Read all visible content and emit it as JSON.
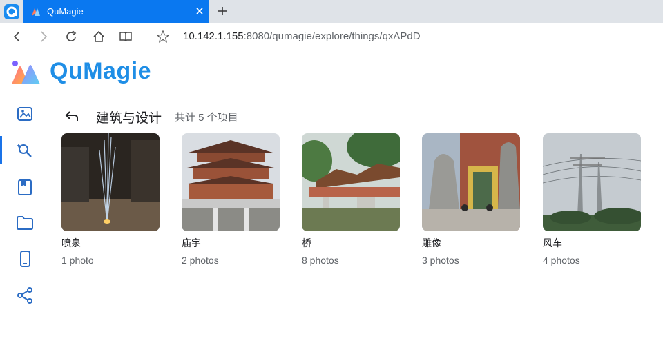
{
  "browser": {
    "tab_title": "QuMagie",
    "url_host": "10.142.1.155",
    "url_rest": ":8080/qumagie/explore/things/qxAPdD",
    "icons": [
      "browser-logo-icon",
      "back-icon",
      "forward-icon",
      "reload-icon",
      "home-icon",
      "reader-icon",
      "star-icon",
      "close-icon",
      "plus-icon"
    ]
  },
  "app": {
    "name": "QuMagie",
    "brand_color": "#1f8ee6"
  },
  "rail": {
    "items": [
      {
        "icon": "photos-icon",
        "active": false
      },
      {
        "icon": "explore-icon",
        "active": true
      },
      {
        "icon": "album-icon",
        "active": false
      },
      {
        "icon": "folder-icon",
        "active": false
      },
      {
        "icon": "phone-icon",
        "active": false
      },
      {
        "icon": "share-icon",
        "active": false
      }
    ]
  },
  "header": {
    "title": "建筑与设计",
    "count": "共计 5 个项目"
  },
  "items": [
    {
      "name": "喷泉",
      "count": "1 photo"
    },
    {
      "name": "庙宇",
      "count": "2 photos"
    },
    {
      "name": "桥",
      "count": "8 photos"
    },
    {
      "name": "雕像",
      "count": "3 photos"
    },
    {
      "name": "风车",
      "count": "4 photos"
    }
  ]
}
